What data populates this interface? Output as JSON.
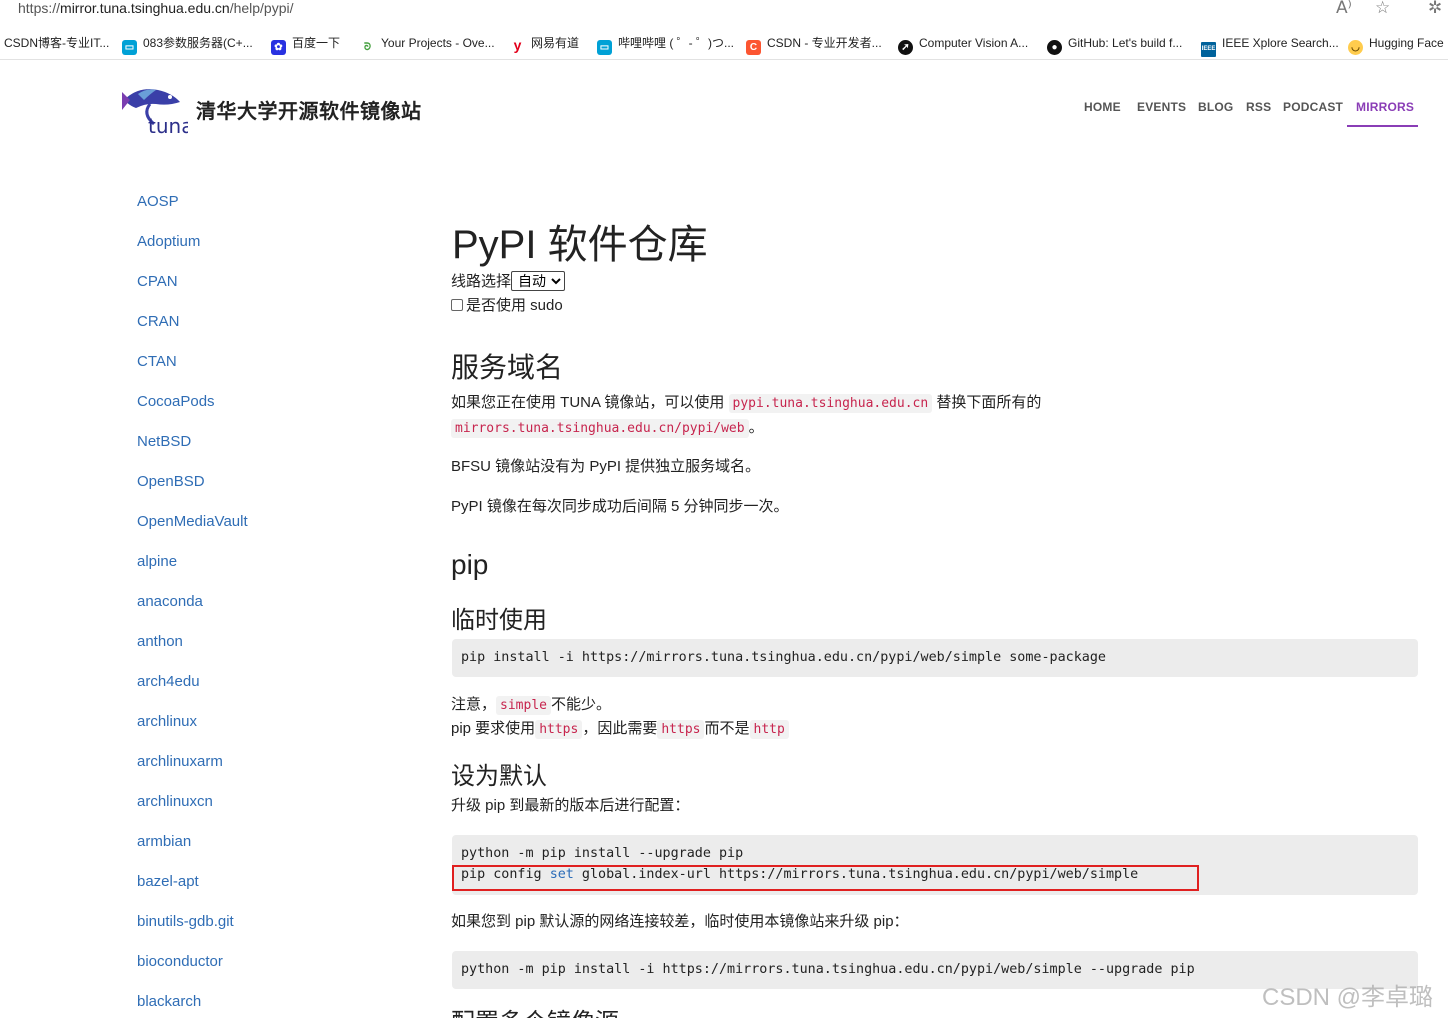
{
  "browser": {
    "url_prefix": "https://",
    "url_host": "mirror.tuna.tsinghua.edu.cn",
    "url_path": "/help/pypi/",
    "bookmarks": [
      {
        "label": "CSDN博客-专业IT...",
        "icon": "none",
        "color": ""
      },
      {
        "label": "083参数服务器(C+...",
        "icon": "tv-icon",
        "color": "#00a1d6"
      },
      {
        "label": "百度一下",
        "icon": "paw-icon",
        "color": "#2932e1"
      },
      {
        "label": "Your Projects - Ove...",
        "icon": "leaf-icon",
        "color": "#47a141"
      },
      {
        "label": "网易有道",
        "icon": "y-icon",
        "color": "#e3001b"
      },
      {
        "label": "哔哩哔哩 ( ゜- ゜)つ...",
        "icon": "tv-icon",
        "color": "#00a1d6"
      },
      {
        "label": "CSDN - 专业开发者...",
        "icon": "c-icon",
        "color": "#fc5531"
      },
      {
        "label": "Computer Vision A...",
        "icon": "arrow-icon",
        "color": "#111111"
      },
      {
        "label": "GitHub: Let's build f...",
        "icon": "github-icon",
        "color": "#111111"
      },
      {
        "label": "IEEE Xplore Search...",
        "icon": "ieee-icon",
        "color": "#00629b"
      },
      {
        "label": "Hugging Face",
        "icon": "emoji-icon",
        "color": "#ffcc4d"
      }
    ]
  },
  "site": {
    "title": "清华大学开源软件镜像站",
    "logo_text": "tuna",
    "nav": [
      "HOME",
      "EVENTS",
      "BLOG",
      "RSS",
      "PODCAST",
      "MIRRORS"
    ],
    "active_nav": "MIRRORS",
    "accent_color": "#8a3db6",
    "link_color": "#2f6db5"
  },
  "sidebar": {
    "items": [
      "AOSP",
      "Adoptium",
      "CPAN",
      "CRAN",
      "CTAN",
      "CocoaPods",
      "NetBSD",
      "OpenBSD",
      "OpenMediaVault",
      "alpine",
      "anaconda",
      "anthon",
      "arch4edu",
      "archlinux",
      "archlinuxarm",
      "archlinuxcn",
      "armbian",
      "bazel-apt",
      "binutils-gdb.git",
      "bioconductor",
      "blackarch"
    ]
  },
  "main": {
    "title": "PyPI 软件仓库",
    "route_label": "线路选择",
    "route_value": "自动",
    "sudo_label": "是否使用 sudo",
    "sudo_checked": false,
    "domain_heading": "服务域名",
    "domain_p1_a": "如果您正在使用 TUNA 镜像站，可以使用",
    "domain_p1_code1": "pypi.tuna.tsinghua.edu.cn",
    "domain_p1_b": "替换下面所有的",
    "domain_p1_code2": "mirrors.tuna.tsinghua.edu.cn/pypi/web",
    "domain_p1_c": "。",
    "domain_p2": "BFSU 镜像站没有为 PyPI 提供独立服务域名。",
    "domain_p3": "PyPI 镜像在每次同步成功后间隔 5 分钟同步一次。",
    "pip_heading": "pip",
    "temp_heading": "临时使用",
    "temp_code": "pip install -i https://mirrors.tuna.tsinghua.edu.cn/pypi/web/simple some-package",
    "note_a": "注意，",
    "note_code": "simple",
    "note_b": "不能少。",
    "https_a": "pip 要求使用",
    "https_code1": "https",
    "https_b": "，因此需要",
    "https_code2": "https",
    "https_c": "而不是",
    "https_code3": "http",
    "default_heading": "设为默认",
    "default_p": "升级 pip 到最新的版本后进行配置：",
    "default_code_line1": "python -m pip install --upgrade pip",
    "default_code_line2_a": "pip config ",
    "default_code_line2_kw": "set",
    "default_code_line2_b": " global.index-url https://mirrors.tuna.tsinghua.edu.cn/pypi/web/simple",
    "slow_p": "如果您到 pip 默认源的网络连接较差，临时使用本镜像站来升级 pip：",
    "slow_code": "python -m pip install -i https://mirrors.tuna.tsinghua.edu.cn/pypi/web/simple --upgrade pip",
    "multi_heading": "配置多个镜像源"
  },
  "watermark": "CSDN @李卓璐"
}
